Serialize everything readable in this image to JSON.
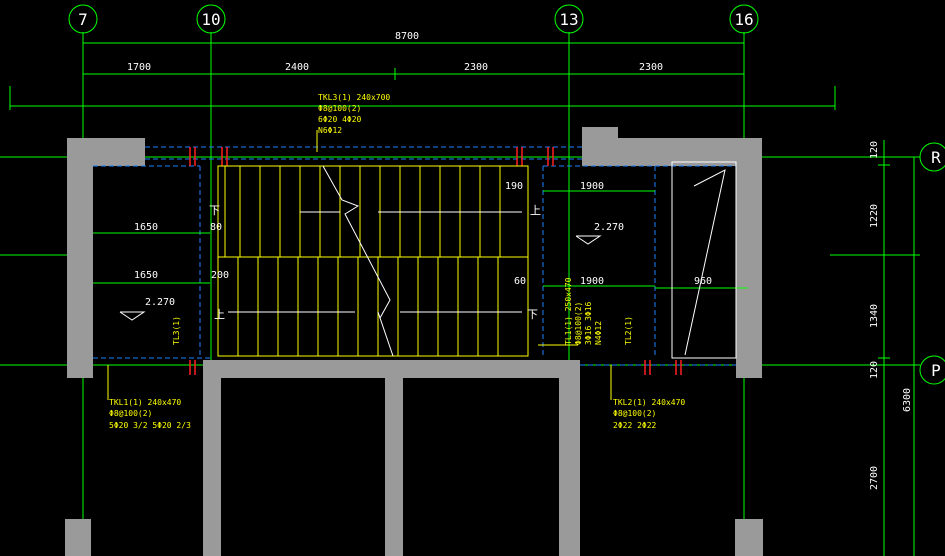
{
  "axes": {
    "top": [
      "7",
      "10",
      "13",
      "16"
    ],
    "right": [
      "R",
      "P"
    ]
  },
  "dimensions": {
    "overall": "8700",
    "bays": [
      "1700",
      "2400",
      "2300",
      "2300"
    ],
    "right_stack": [
      "120",
      "1220",
      "1340",
      "120"
    ],
    "right_bottom": "2700",
    "right_total": "6300"
  },
  "beams": {
    "tkl3": [
      "TKL3(1) 240x700",
      "Φ8@100(2)",
      "6Φ20 4Φ20",
      "N6Φ12"
    ],
    "tkl1": [
      "TKL1(1) 240x470",
      "Φ8@100(2)",
      "5Φ20 3/2 5Φ20 2/3"
    ],
    "tkl2": [
      "TKL2(1) 240x470",
      "Φ8@100(2)",
      "2Φ22 2Φ22"
    ],
    "tl1": [
      "TL1(1) 250x470",
      "Φ8@100(2)",
      "3Φ16 3Φ16",
      "N4Φ12"
    ],
    "tl3_label": "TL3(1)",
    "tl2_label": "TL2(1)"
  },
  "plan_dims": {
    "left_1650_upper": "1650",
    "left_1650_lower": "1650",
    "gap_80": "80",
    "gap_200": "200",
    "gap_190": "190",
    "gap_60": "60",
    "right_1900_upper": "1900",
    "right_1900_lower": "1900",
    "right_960": "960"
  },
  "elevations": {
    "left": "2.270",
    "right": "2.270"
  },
  "stair_marks": {
    "down": "下",
    "up": "上"
  },
  "colors": {
    "background": "#000000",
    "axis_line": "#00ff00",
    "wall": "#9a9a9a",
    "stair": "#ffff00",
    "dim_text": "#ffffff",
    "annotation": "#ffff00",
    "rebar": "#ff2020",
    "hidden": "#2080ff"
  }
}
